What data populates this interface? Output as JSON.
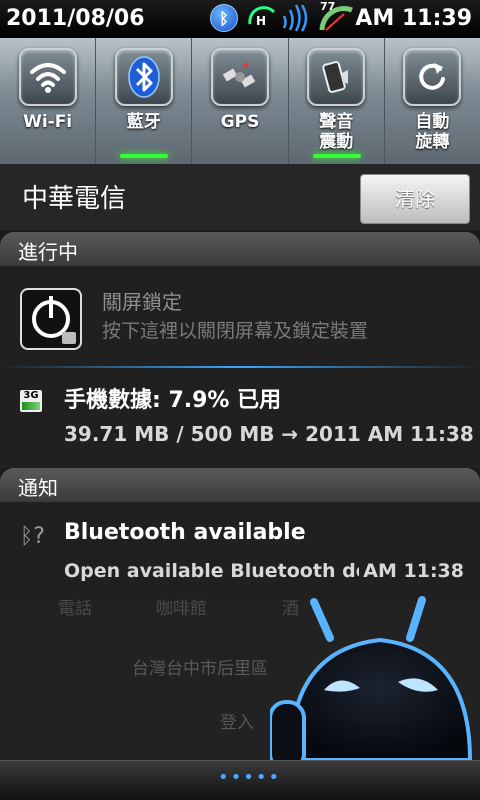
{
  "status_bar": {
    "date": "2011/08/06",
    "time": "AM 11:39",
    "battery_level": "77",
    "network_type": "H"
  },
  "toggles": [
    {
      "label": "Wi-Fi",
      "icon": "wifi-icon",
      "active": false
    },
    {
      "label": "藍牙",
      "icon": "bluetooth-icon",
      "active": true
    },
    {
      "label": "GPS",
      "icon": "gps-satellite-icon",
      "active": false
    },
    {
      "label": "聲音\n震動",
      "icon": "sound-vibrate-icon",
      "active": true
    },
    {
      "label": "自動\n旋轉",
      "icon": "rotate-icon",
      "active": false
    }
  ],
  "carrier": {
    "name": "中華電信",
    "clear_label": "清除"
  },
  "ongoing": {
    "header": "進行中",
    "lock": {
      "title": "關屏鎖定",
      "subtitle": "按下這裡以關閉屏幕及鎖定裝置"
    },
    "data_usage": {
      "badge": "3G",
      "title": "手機數據: 7.9% 已用",
      "subtitle": "39.71 MB / 500 MB → 2011 AM 11:38"
    }
  },
  "notifications": {
    "header": "通知",
    "bluetooth": {
      "title": "Bluetooth available",
      "subtitle": "Open available Bluetooth devi",
      "time": "AM 11:38"
    }
  },
  "background": {
    "label_1": "電話",
    "label_2": "咖啡館",
    "label_3": "酒",
    "location": "台灣台中市后里區",
    "login": "登入"
  },
  "colors": {
    "accent_blue": "#3aa7ff",
    "active_green": "#33ff33"
  }
}
